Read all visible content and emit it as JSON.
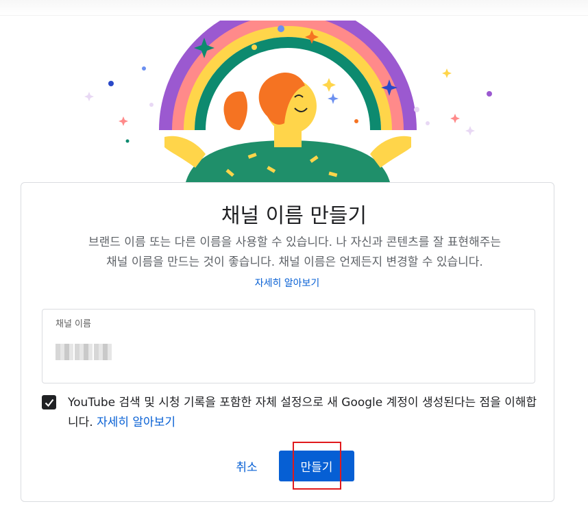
{
  "dialog": {
    "title": "채널 이름 만들기",
    "description_line1": "브랜드 이름 또는 다른 이름을 사용할 수 있습니다. 나 자신과 콘텐츠를 잘 표현해주는",
    "description_line2": "채널 이름을 만드는 것이 좋습니다. 채널 이름은 언제든지 변경할 수 있습니다.",
    "learn_more": "자세히 알아보기",
    "field_label": "채널 이름",
    "field_value_obscured": true,
    "consent_text": "YouTube 검색 및 시청 기록을 포함한 자체 설정으로 새 Google 계정이 생성된다는 점을 이해합니다.",
    "consent_link": "자세히 알아보기",
    "consent_checked": true,
    "cancel_label": "취소",
    "create_label": "만들기"
  },
  "colors": {
    "accent": "#065fd4",
    "annotation_box": "#e0191c",
    "checkbox": "#202124"
  },
  "icons": [
    "rainbow-illustration",
    "checkmark-icon",
    "sparkle-icon"
  ]
}
